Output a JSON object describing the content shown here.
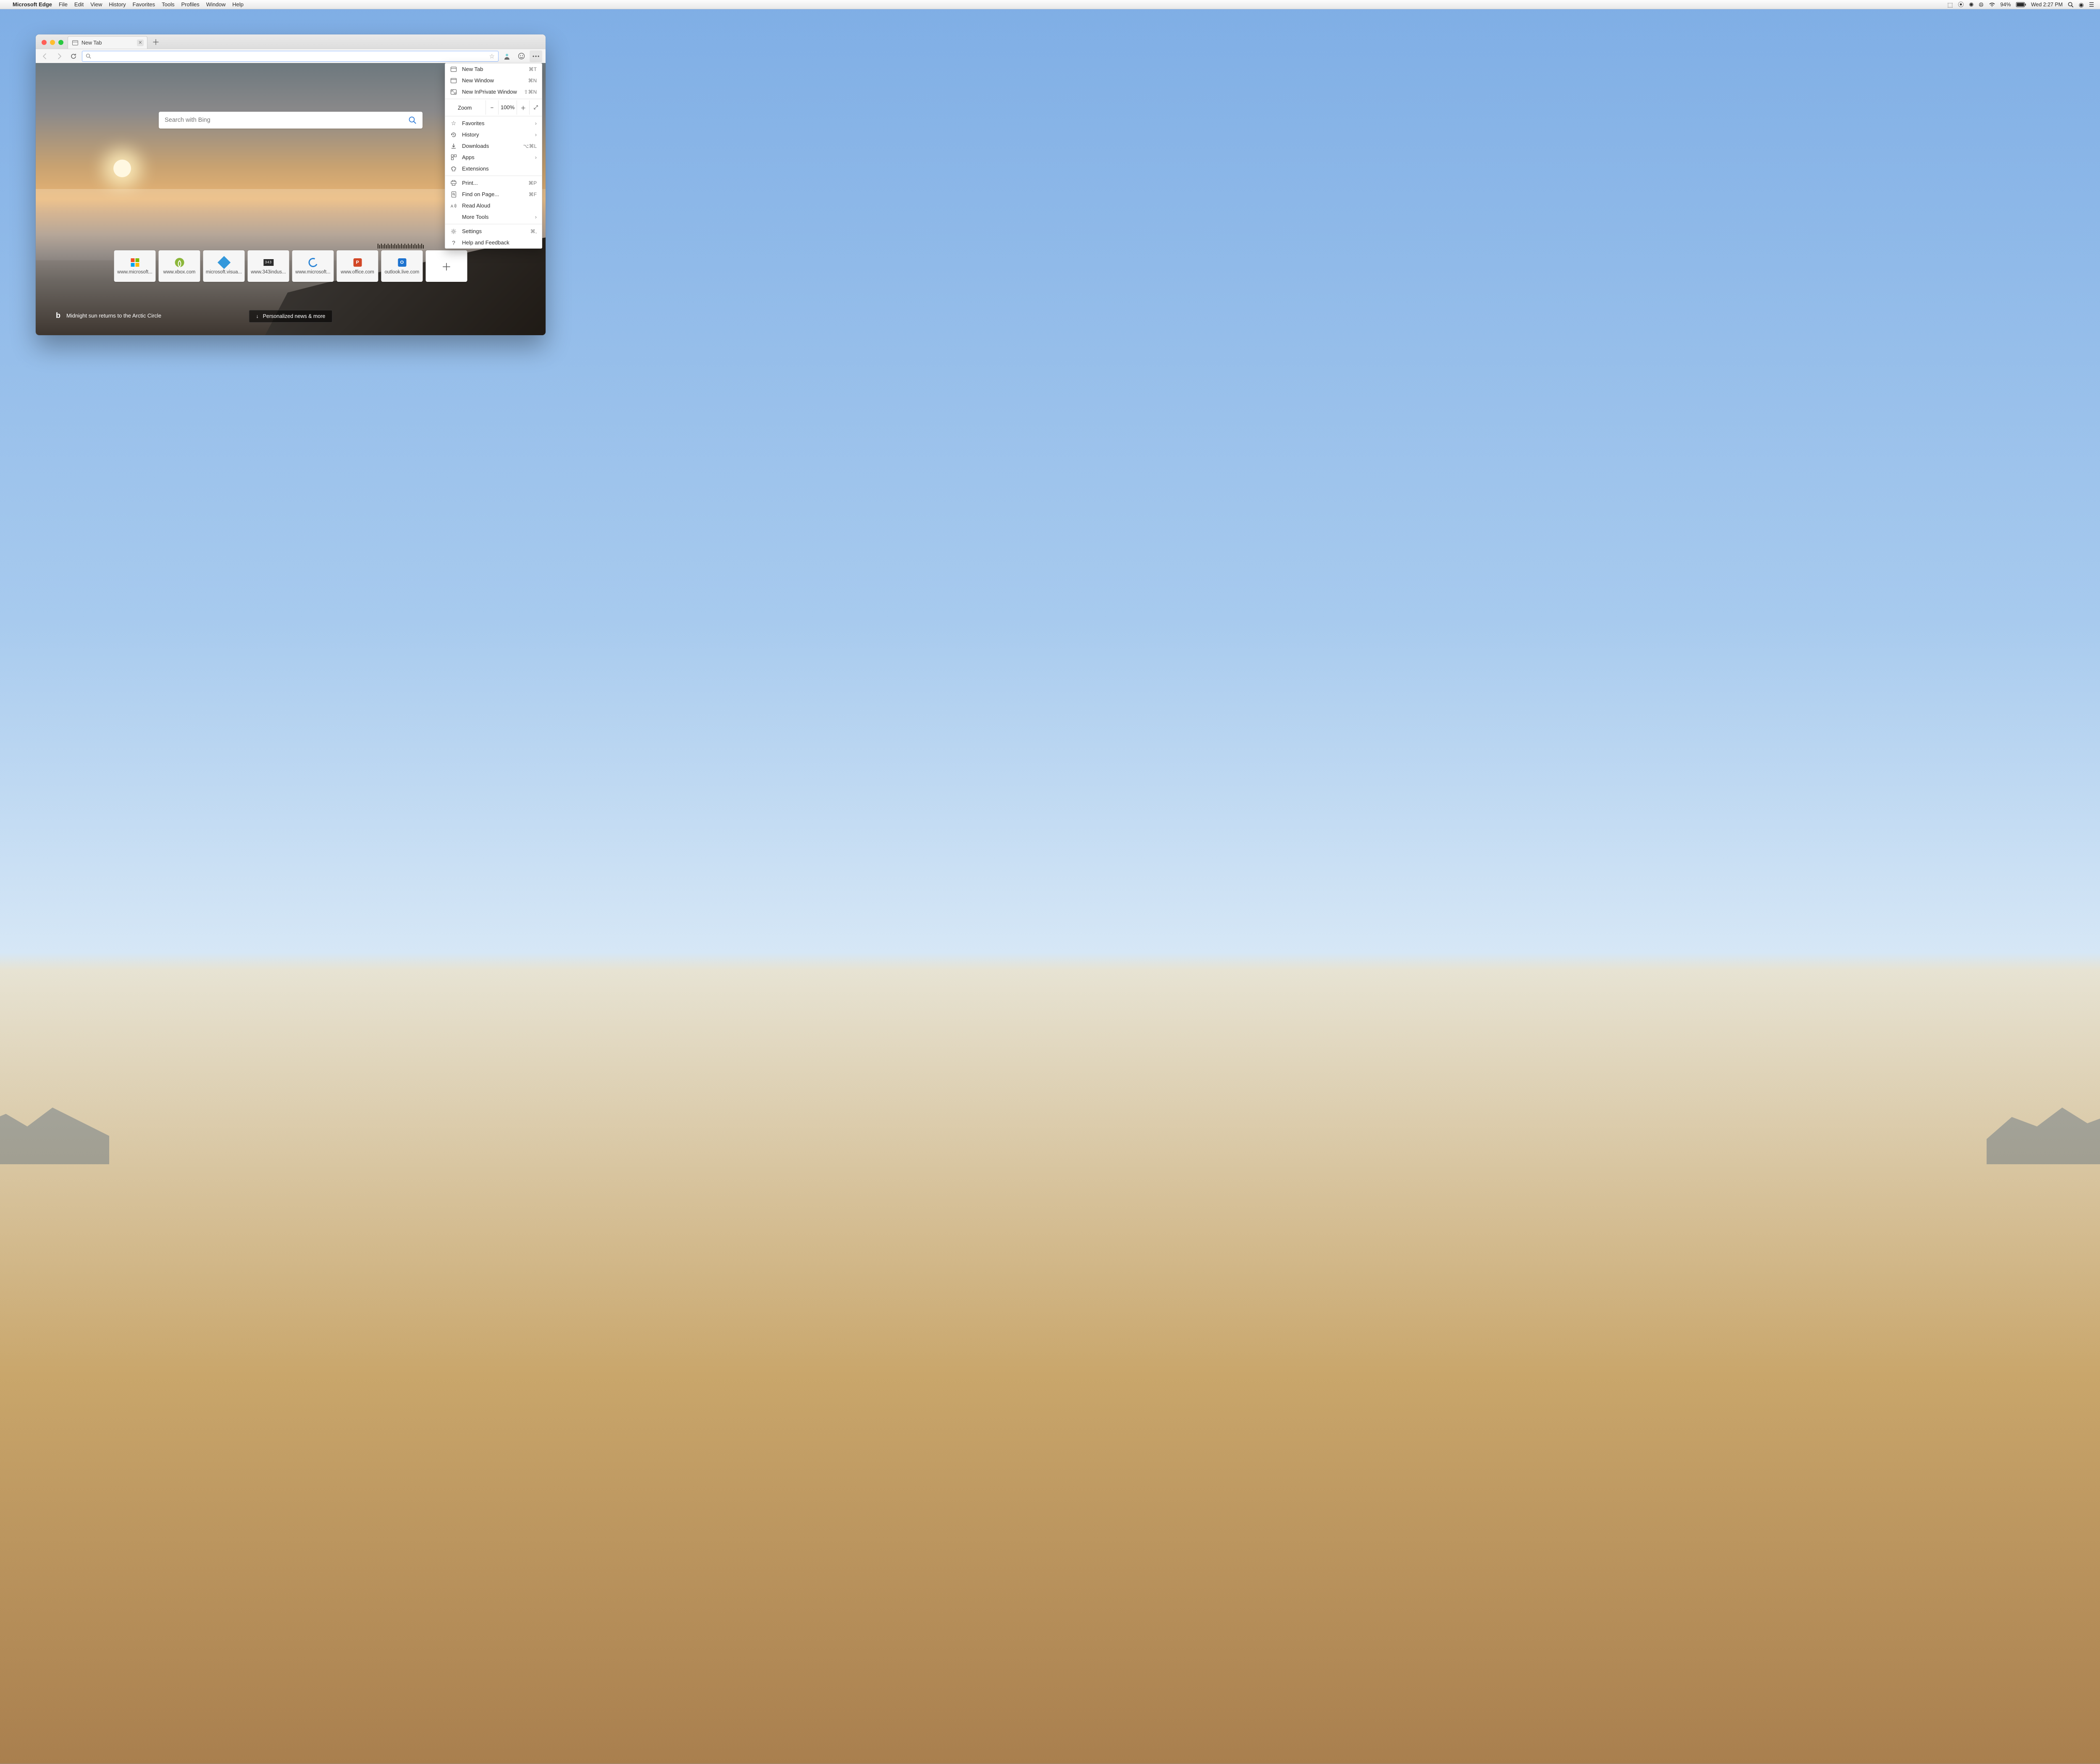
{
  "macMenu": {
    "appname": "Microsoft Edge",
    "items": [
      "File",
      "Edit",
      "View",
      "History",
      "Favorites",
      "Tools",
      "Profiles",
      "Window",
      "Help"
    ],
    "battery": "94%",
    "clock": "Wed 2:27 PM"
  },
  "tabStrip": {
    "activeTab": "New Tab"
  },
  "toolbar": {
    "omniboxPlaceholder": ""
  },
  "ntp": {
    "searchPlaceholder": "Search with Bing",
    "caption": "Midnight sun returns to the Arctic Circle",
    "newsPill": "Personalized news & more",
    "tiles": [
      {
        "label": "www.microsoft..."
      },
      {
        "label": "www.xbox.com"
      },
      {
        "label": "microsoft.visua..."
      },
      {
        "label": "www.343indus..."
      },
      {
        "label": "www.microsoft..."
      },
      {
        "label": "www.office.com"
      },
      {
        "label": "outlook.live.com"
      }
    ]
  },
  "dropdown": {
    "newTab": {
      "label": "New Tab",
      "shortcut": "⌘T"
    },
    "newWindow": {
      "label": "New Window",
      "shortcut": "⌘N"
    },
    "newInPrivate": {
      "label": "New InPrivate Window",
      "shortcut": "⇧⌘N"
    },
    "zoom": {
      "label": "Zoom",
      "value": "100%"
    },
    "favorites": {
      "label": "Favorites"
    },
    "history": {
      "label": "History"
    },
    "downloads": {
      "label": "Downloads",
      "shortcut": "⌥⌘L"
    },
    "apps": {
      "label": "Apps"
    },
    "extensions": {
      "label": "Extensions"
    },
    "print": {
      "label": "Print...",
      "shortcut": "⌘P"
    },
    "find": {
      "label": "Find on Page...",
      "shortcut": "⌘F"
    },
    "readAloud": {
      "label": "Read Aloud"
    },
    "moreTools": {
      "label": "More Tools"
    },
    "settings": {
      "label": "Settings",
      "shortcut": "⌘,"
    },
    "help": {
      "label": "Help and Feedback"
    }
  }
}
